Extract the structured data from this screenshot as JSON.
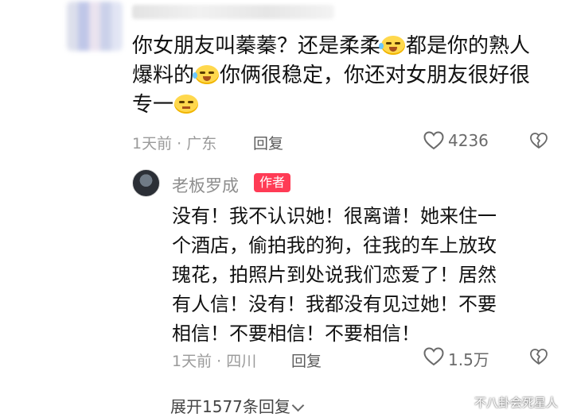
{
  "top_comment": {
    "line1_a": "你女朋友叫蓁蓁？还是柔柔",
    "line1_b": "都是你的熟人",
    "line2_a": "爆料的",
    "line2_b": "你俩很稳定，你还对女朋友很好很",
    "line3": "专一",
    "meta": "1天前 · 广东",
    "reply_label": "回复",
    "likes": "4236"
  },
  "author_reply": {
    "author_name": "老板罗成",
    "badge": "作者",
    "lines": [
      "没有！我不认识她！很离谱！她来住一",
      "个酒店，偷拍我的狗，往我的车上放玫",
      "瑰花，拍照片到处说我们恋爱了！居然",
      "有人信！没有！我都没有见过她！不要",
      "相信！不要相信！不要相信！"
    ],
    "meta": "1天前 · 四川",
    "reply_label": "回复",
    "likes": "1.5万"
  },
  "expand_label": "展开1577条回复",
  "watermark": "不八卦会死星人",
  "colors": {
    "badge": "#ff3b55",
    "meta": "#9a9a9a"
  },
  "icons": [
    "heart-outline-icon",
    "broken-heart-icon",
    "chevron-down-icon",
    "laugh-cry-emoji",
    "smirk-emoji"
  ]
}
